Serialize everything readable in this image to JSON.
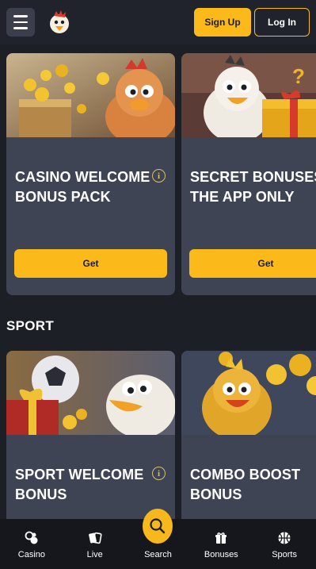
{
  "header": {
    "menu_icon": "hamburger-menu-icon",
    "logo_icon": "chicken-logo-icon",
    "signup_label": "Sign Up",
    "login_label": "Log In"
  },
  "promos": [
    {
      "title": "CASINO WELCOME BONUS PACK",
      "button": "Get",
      "info_glyph": "i"
    },
    {
      "title": "SECRET BONUSES IN THE APP ONLY",
      "button": "Get"
    },
    {
      "title": "SPORT WELCOME BONUS",
      "info_glyph": "i"
    },
    {
      "title": "COMBO BOOST BONUS"
    }
  ],
  "sections": {
    "sport": "SPORT"
  },
  "nav": {
    "casino": "Casino",
    "live": "Live",
    "search": "Search",
    "bonuses": "Bonuses",
    "sports": "Sports"
  },
  "colors": {
    "accent": "#fbb91a",
    "background": "#1c1f26",
    "card": "#3f4454",
    "nav": "#15171c"
  }
}
